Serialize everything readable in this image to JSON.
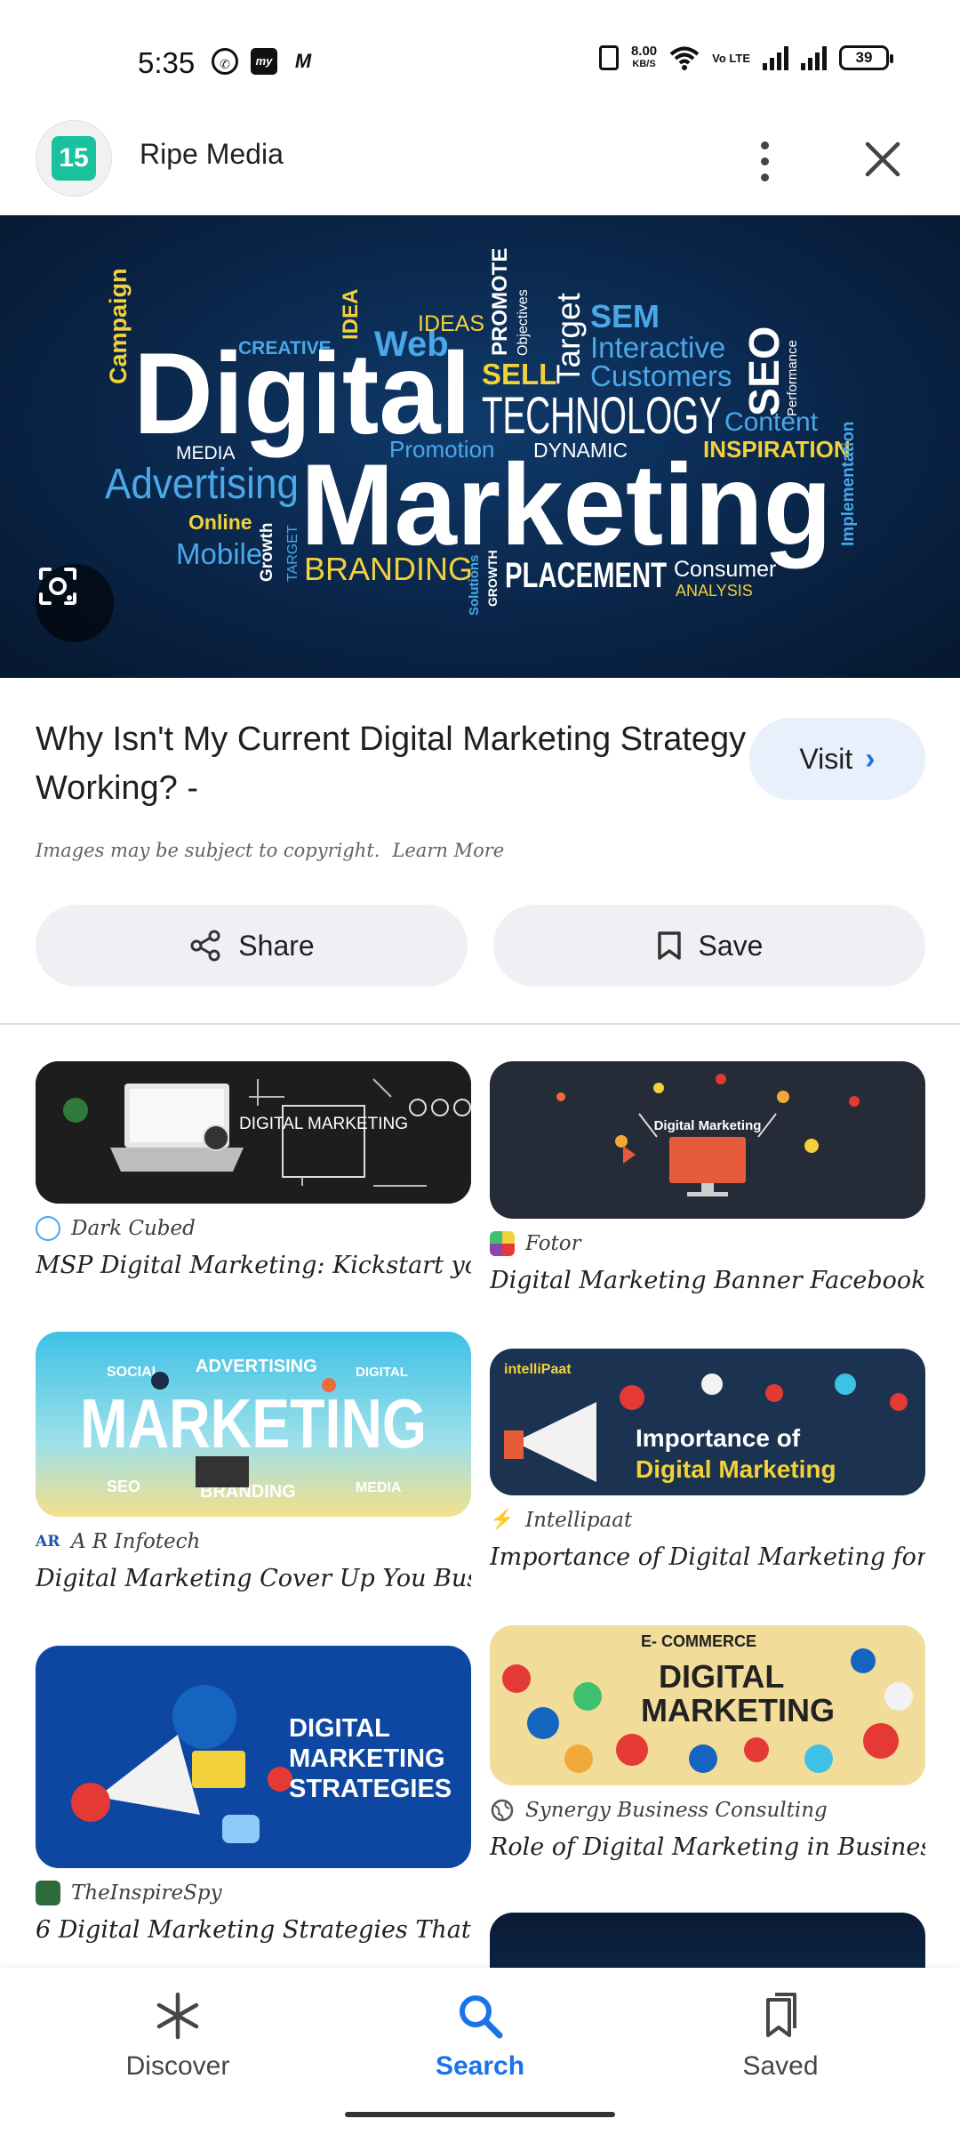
{
  "status_bar": {
    "time": "5:35",
    "net_speed": "8.00",
    "net_unit": "KB/S",
    "volte": "Vo LTE",
    "battery": "39"
  },
  "header": {
    "site_logo_text": "15",
    "site_name": "Ripe Media"
  },
  "hero": {
    "words": {
      "campaign": "Campaign",
      "creative": "CREATIVE",
      "idea": "IDEA",
      "web": "Web",
      "ideas": "IDEAS",
      "promote": "PROMOTE",
      "objectives": "Objectives",
      "target": "Target",
      "sem": "SEM",
      "interactive": "Interactive",
      "customers": "Customers",
      "seo": "SEO",
      "performance": "Performance",
      "digital": "Digital",
      "sell": "SELL",
      "technology": "TECHNOLOGY",
      "content": "Content",
      "media": "MEDIA",
      "promotion": "Promotion",
      "dynamic": "DYNAMIC",
      "inspiration": "INSPIRATION",
      "advertising": "Advertising",
      "marketing": "Marketing",
      "implementation": "Implementation",
      "online": "Online",
      "mobile": "Mobile",
      "growth": "Growth",
      "target2": "TARGET",
      "branding": "BRANDING",
      "solutions": "Solutions",
      "growth2": "GROWTH",
      "placement": "PLACEMENT",
      "consumer": "Consumer",
      "analysis": "ANALYSIS"
    }
  },
  "result": {
    "title": "Why Isn't My Current Digital Marketing Strategy Working? -",
    "visit_label": "Visit",
    "copyright": "Images may be subject to copyright.",
    "learn_more": "Learn More",
    "share_label": "Share",
    "save_label": "Save"
  },
  "related": [
    {
      "source": "Dark Cubed",
      "title": "MSP Digital Marketing: Kickstart yo.",
      "thumb_text": "DIGITAL MARKETING"
    },
    {
      "source": "Fotor",
      "title": "Digital Marketing Banner Facebook C.",
      "thumb_text": "Digital Marketing"
    },
    {
      "source": "A R Infotech",
      "title": "Digital Marketing Cover Up You Busi.",
      "thumb_text": "MARKETING",
      "thumb_sub": [
        "SOCIAL",
        "ADVERTISING",
        "DIGITAL",
        "SEO",
        "BRANDING",
        "MEDIA"
      ]
    },
    {
      "source": "Intellipaat",
      "title": "Importance of Digital Marketing for t.",
      "thumb_text": "Importance of",
      "thumb_text2": "Digital Marketing",
      "thumb_logo": "intelliPaat"
    },
    {
      "source": "TheInspireSpy",
      "title": "6 Digital Marketing Strategies That .",
      "thumb_text": "DIGITAL",
      "thumb_text2": "MARKETING",
      "thumb_text3": "STRATEGIES"
    },
    {
      "source": "Synergy Business Consulting",
      "title": "Role of Digital Marketing in Business.",
      "thumb_text": "DIGITAL",
      "thumb_text2": "MARKETING",
      "thumb_small": "E- COMMERCE"
    }
  ],
  "bottom_nav": {
    "discover": "Discover",
    "search": "Search",
    "saved": "Saved"
  },
  "colors": {
    "accent": "#1a73e8",
    "visit_bg": "#e8f0fc",
    "button_bg": "#eef0f3",
    "hero_bg": "#0a2548"
  }
}
